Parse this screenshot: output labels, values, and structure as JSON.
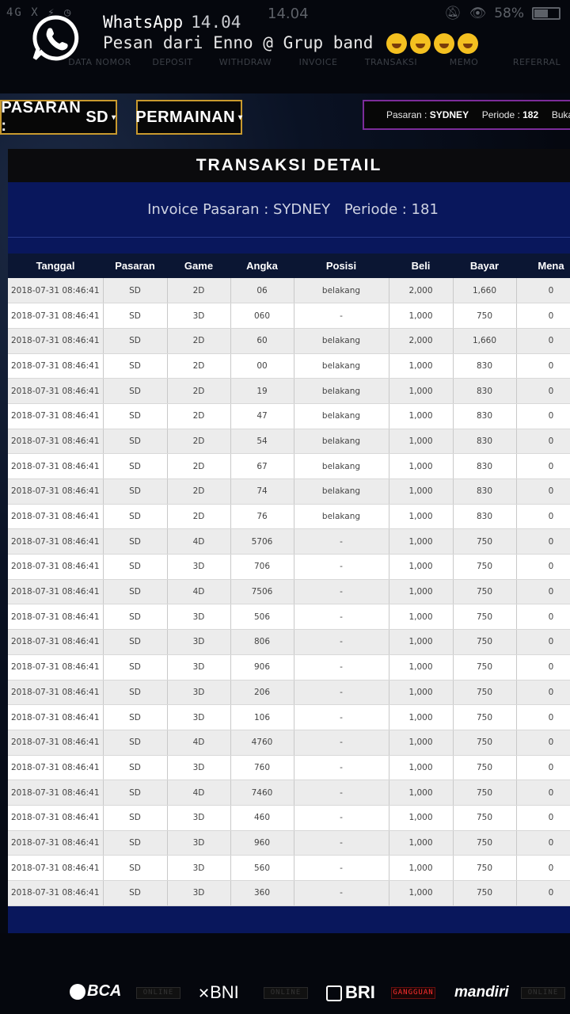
{
  "status": {
    "left": "4G  X  ⚡  ◷",
    "time": "14.04",
    "battery": "58%",
    "battery_level": 0.58
  },
  "notification": {
    "app": "WhatsApp",
    "time": "14.04",
    "message": "Pesan dari Enno @ Grup band"
  },
  "topnav": [
    "DATA NOMOR",
    "DEPOSIT",
    "WITHDRAW",
    "INVOICE",
    "TRANSAKSI",
    "MEMO",
    "REFERRAL"
  ],
  "pasaran_select": {
    "label": "PASARAN :",
    "value": "SD"
  },
  "permainan_select": {
    "label": "PERMAINAN"
  },
  "ticker": {
    "pasaran_label": "Pasaran :",
    "pasaran": "SYDNEY",
    "periode_label": "Periode :",
    "periode": "182",
    "trailing": "Buka"
  },
  "panel": {
    "title": "TRANSAKSI DETAIL",
    "invoice_label": "Invoice Pasaran : SYDNEY",
    "periode_label": "Periode : 181"
  },
  "table": {
    "columns": [
      "Tanggal",
      "Pasaran",
      "Game",
      "Angka",
      "Posisi",
      "Beli",
      "Bayar",
      "Mena"
    ],
    "rows": [
      [
        "2018-07-31 08:46:41",
        "SD",
        "2D",
        "06",
        "belakang",
        "2,000",
        "1,660",
        "0"
      ],
      [
        "2018-07-31 08:46:41",
        "SD",
        "3D",
        "060",
        "-",
        "1,000",
        "750",
        "0"
      ],
      [
        "2018-07-31 08:46:41",
        "SD",
        "2D",
        "60",
        "belakang",
        "2,000",
        "1,660",
        "0"
      ],
      [
        "2018-07-31 08:46:41",
        "SD",
        "2D",
        "00",
        "belakang",
        "1,000",
        "830",
        "0"
      ],
      [
        "2018-07-31 08:46:41",
        "SD",
        "2D",
        "19",
        "belakang",
        "1,000",
        "830",
        "0"
      ],
      [
        "2018-07-31 08:46:41",
        "SD",
        "2D",
        "47",
        "belakang",
        "1,000",
        "830",
        "0"
      ],
      [
        "2018-07-31 08:46:41",
        "SD",
        "2D",
        "54",
        "belakang",
        "1,000",
        "830",
        "0"
      ],
      [
        "2018-07-31 08:46:41",
        "SD",
        "2D",
        "67",
        "belakang",
        "1,000",
        "830",
        "0"
      ],
      [
        "2018-07-31 08:46:41",
        "SD",
        "2D",
        "74",
        "belakang",
        "1,000",
        "830",
        "0"
      ],
      [
        "2018-07-31 08:46:41",
        "SD",
        "2D",
        "76",
        "belakang",
        "1,000",
        "830",
        "0"
      ],
      [
        "2018-07-31 08:46:41",
        "SD",
        "4D",
        "5706",
        "-",
        "1,000",
        "750",
        "0"
      ],
      [
        "2018-07-31 08:46:41",
        "SD",
        "3D",
        "706",
        "-",
        "1,000",
        "750",
        "0"
      ],
      [
        "2018-07-31 08:46:41",
        "SD",
        "4D",
        "7506",
        "-",
        "1,000",
        "750",
        "0"
      ],
      [
        "2018-07-31 08:46:41",
        "SD",
        "3D",
        "506",
        "-",
        "1,000",
        "750",
        "0"
      ],
      [
        "2018-07-31 08:46:41",
        "SD",
        "3D",
        "806",
        "-",
        "1,000",
        "750",
        "0"
      ],
      [
        "2018-07-31 08:46:41",
        "SD",
        "3D",
        "906",
        "-",
        "1,000",
        "750",
        "0"
      ],
      [
        "2018-07-31 08:46:41",
        "SD",
        "3D",
        "206",
        "-",
        "1,000",
        "750",
        "0"
      ],
      [
        "2018-07-31 08:46:41",
        "SD",
        "3D",
        "106",
        "-",
        "1,000",
        "750",
        "0"
      ],
      [
        "2018-07-31 08:46:41",
        "SD",
        "4D",
        "4760",
        "-",
        "1,000",
        "750",
        "0"
      ],
      [
        "2018-07-31 08:46:41",
        "SD",
        "3D",
        "760",
        "-",
        "1,000",
        "750",
        "0"
      ],
      [
        "2018-07-31 08:46:41",
        "SD",
        "4D",
        "7460",
        "-",
        "1,000",
        "750",
        "0"
      ],
      [
        "2018-07-31 08:46:41",
        "SD",
        "3D",
        "460",
        "-",
        "1,000",
        "750",
        "0"
      ],
      [
        "2018-07-31 08:46:41",
        "SD",
        "3D",
        "960",
        "-",
        "1,000",
        "750",
        "0"
      ],
      [
        "2018-07-31 08:46:41",
        "SD",
        "3D",
        "560",
        "-",
        "1,000",
        "750",
        "0"
      ],
      [
        "2018-07-31 08:46:41",
        "SD",
        "3D",
        "360",
        "-",
        "1,000",
        "750",
        "0"
      ]
    ]
  },
  "footer": {
    "banks": [
      {
        "name": "BCA",
        "status": "ONLINE"
      },
      {
        "name": "BNI",
        "status": "ONLINE"
      },
      {
        "name": "BRI",
        "status": "GANGGUAN"
      },
      {
        "name": "mandiri",
        "status": "ONLINE"
      }
    ]
  },
  "colors": {
    "accent_gold": "#c99a2e",
    "ticker_border": "#7c2c9a",
    "panel_blue": "#09175c",
    "status_offline": "#ff3030"
  }
}
